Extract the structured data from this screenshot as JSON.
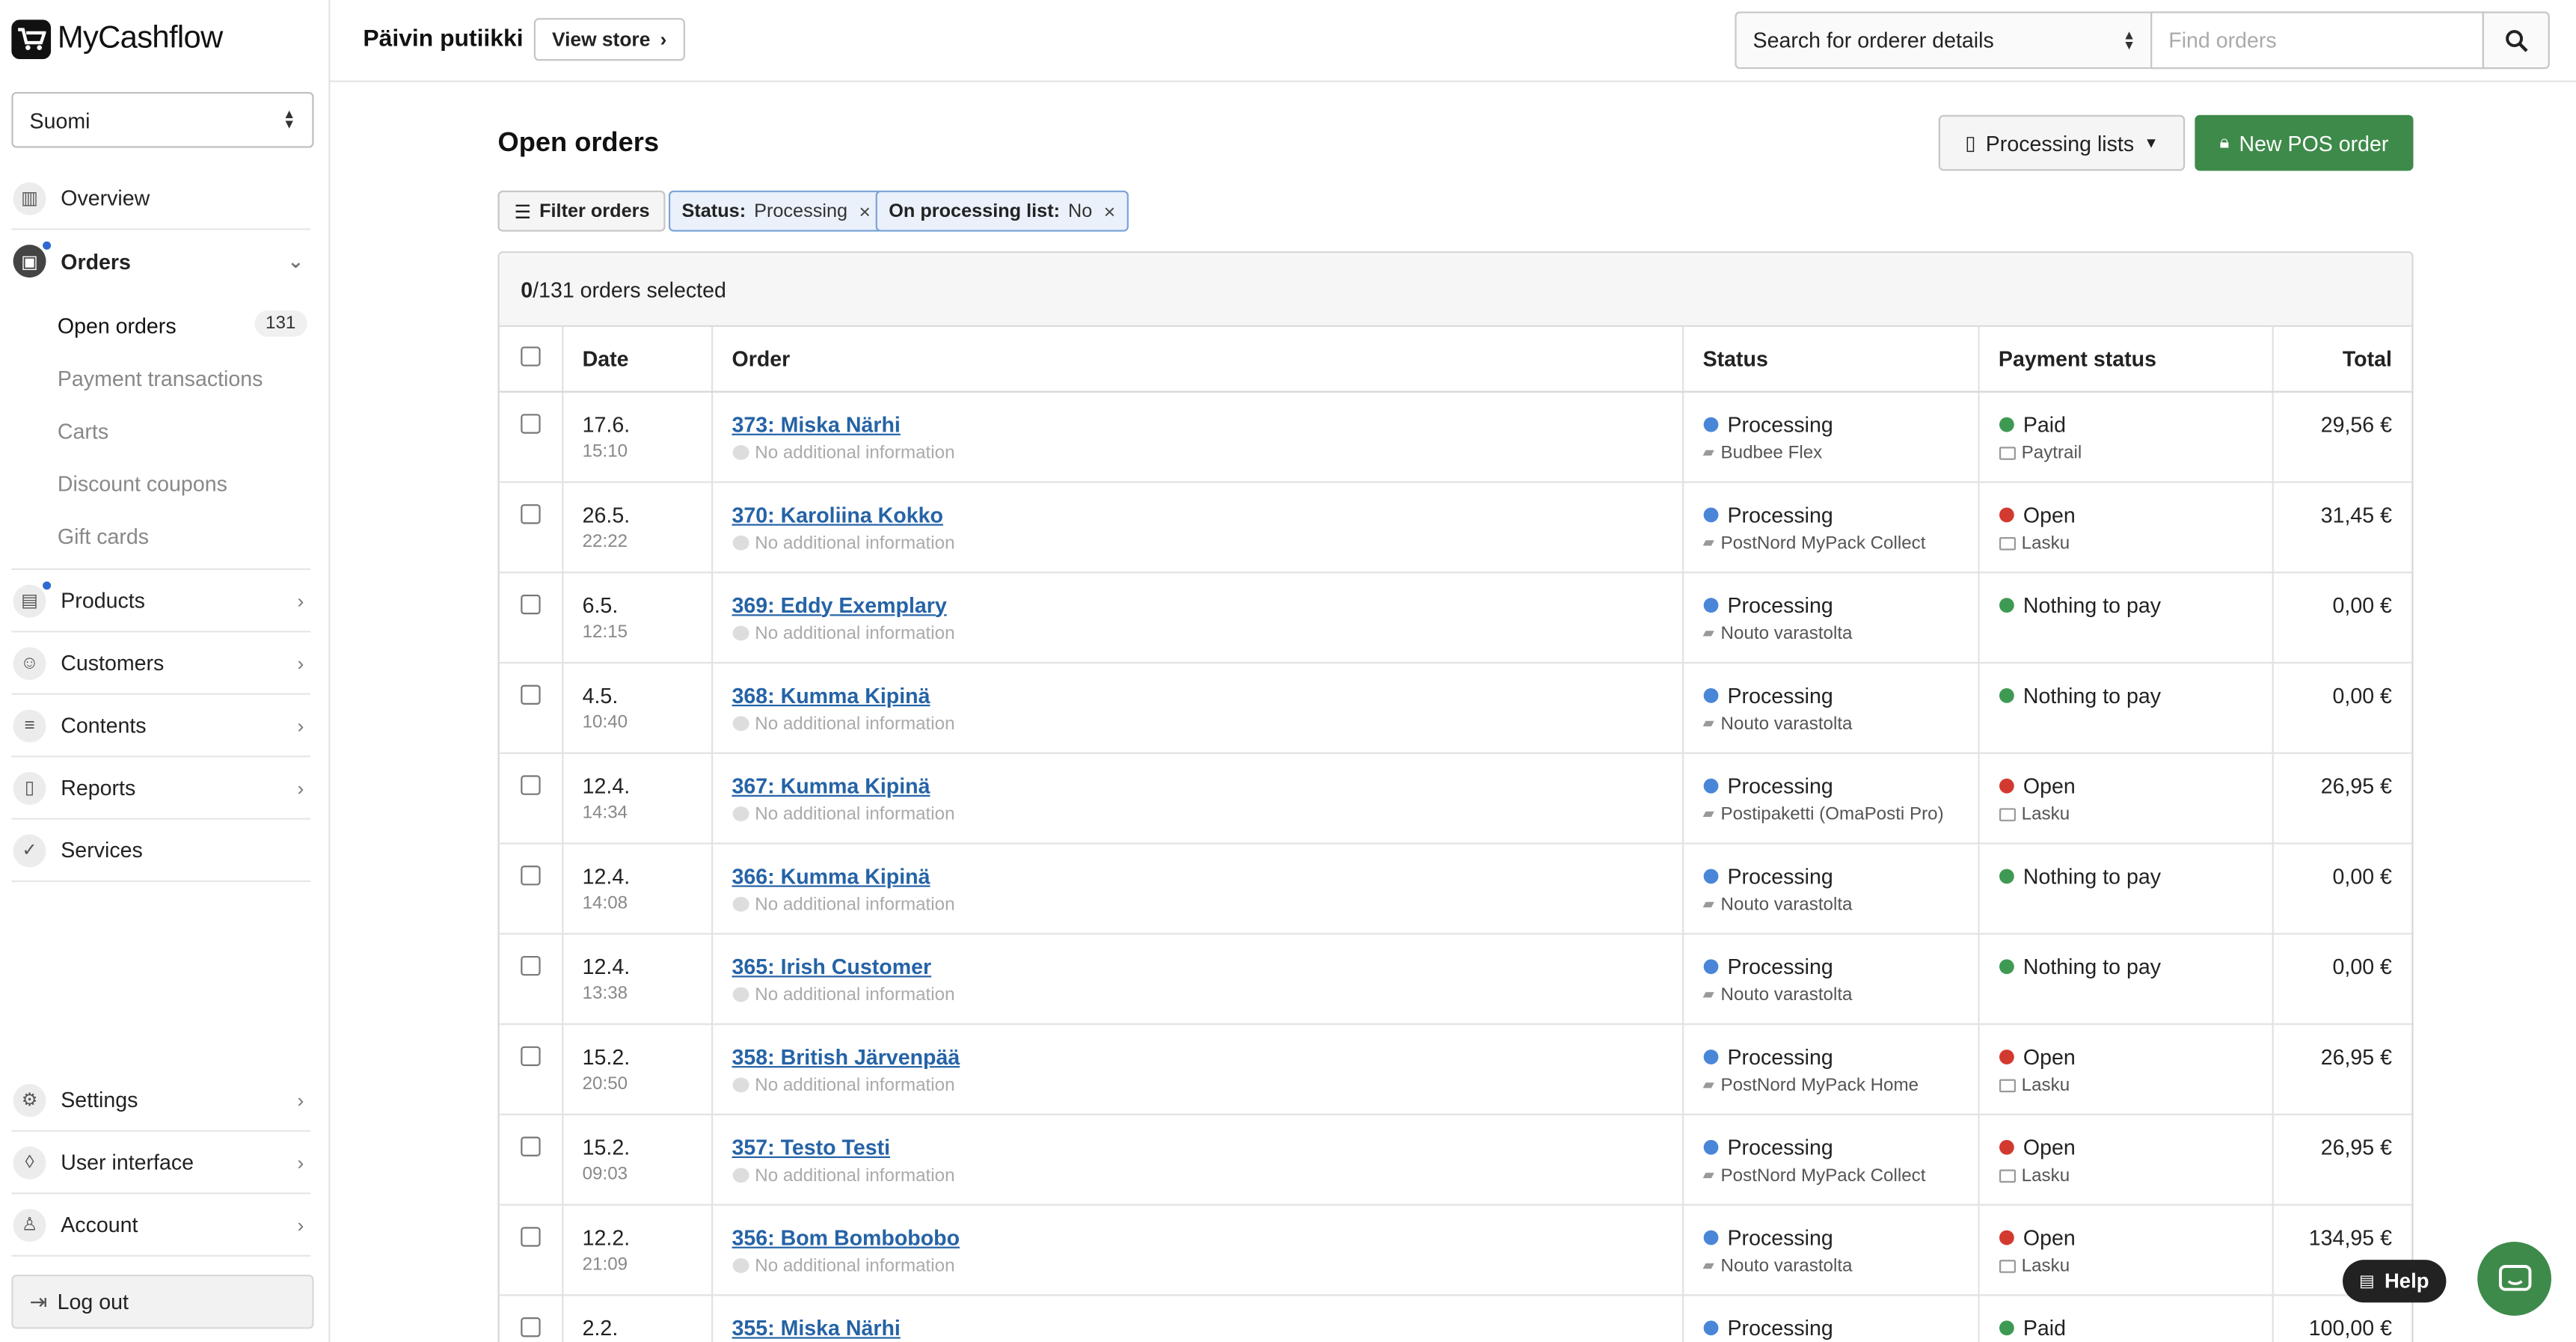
{
  "app": {
    "name": "MyCashflow"
  },
  "sidebar": {
    "language": "Suomi",
    "nav": {
      "overview": "Overview",
      "orders": "Orders",
      "products": "Products",
      "customers": "Customers",
      "contents": "Contents",
      "reports": "Reports",
      "services": "Services",
      "settings": "Settings",
      "user_interface": "User interface",
      "account": "Account"
    },
    "orders_sub": {
      "open_orders": "Open orders",
      "open_orders_count": "131",
      "payment_transactions": "Payment transactions",
      "carts": "Carts",
      "discount_coupons": "Discount coupons",
      "gift_cards": "Gift cards"
    },
    "logout": "Log out"
  },
  "topbar": {
    "store_name": "Päivin putiikki",
    "view_store": "View store",
    "search_mode": "Search for orderer details",
    "search_placeholder": "Find orders"
  },
  "main": {
    "title": "Open orders",
    "processing_lists": "Processing lists",
    "new_pos_order": "New POS order",
    "filter_orders": "Filter orders",
    "chips": [
      {
        "label": "Status:",
        "value": "Processing"
      },
      {
        "label": "On processing list:",
        "value": "No"
      }
    ],
    "selected_count": "0",
    "selected_suffix": "/131 orders selected",
    "columns": {
      "date": "Date",
      "order": "Order",
      "status": "Status",
      "payment": "Payment status",
      "total": "Total"
    },
    "rows": [
      {
        "date": "17.6.",
        "time": "15:10",
        "order": "373: Miska Närhi",
        "info": "No additional information",
        "status": "Processing",
        "shipping": "Budbee Flex",
        "payment": "Paid",
        "payment_color": "#3e9a52",
        "method": "Paytrail",
        "total": "29,56 €"
      },
      {
        "date": "26.5.",
        "time": "22:22",
        "order": "370: Karoliina Kokko",
        "info": "No additional information",
        "status": "Processing",
        "shipping": "PostNord MyPack Collect",
        "payment": "Open",
        "payment_color": "#d23a2f",
        "method": "Lasku",
        "total": "31,45 €"
      },
      {
        "date": "6.5.",
        "time": "12:15",
        "order": "369: Eddy Exemplary",
        "info": "No additional information",
        "status": "Processing",
        "shipping": "Nouto varastolta",
        "payment": "Nothing to pay",
        "payment_color": "#3e9a52",
        "method": "",
        "total": "0,00 €"
      },
      {
        "date": "4.5.",
        "time": "10:40",
        "order": "368: Kumma Kipinä",
        "info": "No additional information",
        "status": "Processing",
        "shipping": "Nouto varastolta",
        "payment": "Nothing to pay",
        "payment_color": "#3e9a52",
        "method": "",
        "total": "0,00 €"
      },
      {
        "date": "12.4.",
        "time": "14:34",
        "order": "367: Kumma Kipinä",
        "info": "No additional information",
        "status": "Processing",
        "shipping": "Postipaketti (OmaPosti Pro)",
        "payment": "Open",
        "payment_color": "#d23a2f",
        "method": "Lasku",
        "total": "26,95 €"
      },
      {
        "date": "12.4.",
        "time": "14:08",
        "order": "366: Kumma Kipinä",
        "info": "No additional information",
        "status": "Processing",
        "shipping": "Nouto varastolta",
        "payment": "Nothing to pay",
        "payment_color": "#3e9a52",
        "method": "",
        "total": "0,00 €"
      },
      {
        "date": "12.4.",
        "time": "13:38",
        "order": "365: Irish Customer",
        "info": "No additional information",
        "status": "Processing",
        "shipping": "Nouto varastolta",
        "payment": "Nothing to pay",
        "payment_color": "#3e9a52",
        "method": "",
        "total": "0,00 €"
      },
      {
        "date": "15.2.",
        "time": "20:50",
        "order": "358: British Järvenpää",
        "info": "No additional information",
        "status": "Processing",
        "shipping": "PostNord MyPack Home",
        "payment": "Open",
        "payment_color": "#d23a2f",
        "method": "Lasku",
        "total": "26,95 €"
      },
      {
        "date": "15.2.",
        "time": "09:03",
        "order": "357: Testo Testi",
        "info": "No additional information",
        "status": "Processing",
        "shipping": "PostNord MyPack Collect",
        "payment": "Open",
        "payment_color": "#d23a2f",
        "method": "Lasku",
        "total": "26,95 €"
      },
      {
        "date": "12.2.",
        "time": "21:09",
        "order": "356: Bom Bombobobo",
        "info": "No additional information",
        "status": "Processing",
        "shipping": "Nouto varastolta",
        "payment": "Open",
        "payment_color": "#d23a2f",
        "method": "Lasku",
        "total": "134,95 €"
      },
      {
        "date": "2.2.",
        "time": "",
        "order": "355: Miska Närhi",
        "info": "",
        "status": "Processing",
        "shipping": "",
        "payment": "Paid",
        "payment_color": "#3e9a52",
        "method": "",
        "total": "100,00 €"
      }
    ],
    "status_color": "#4a86d8"
  },
  "help": "Help"
}
